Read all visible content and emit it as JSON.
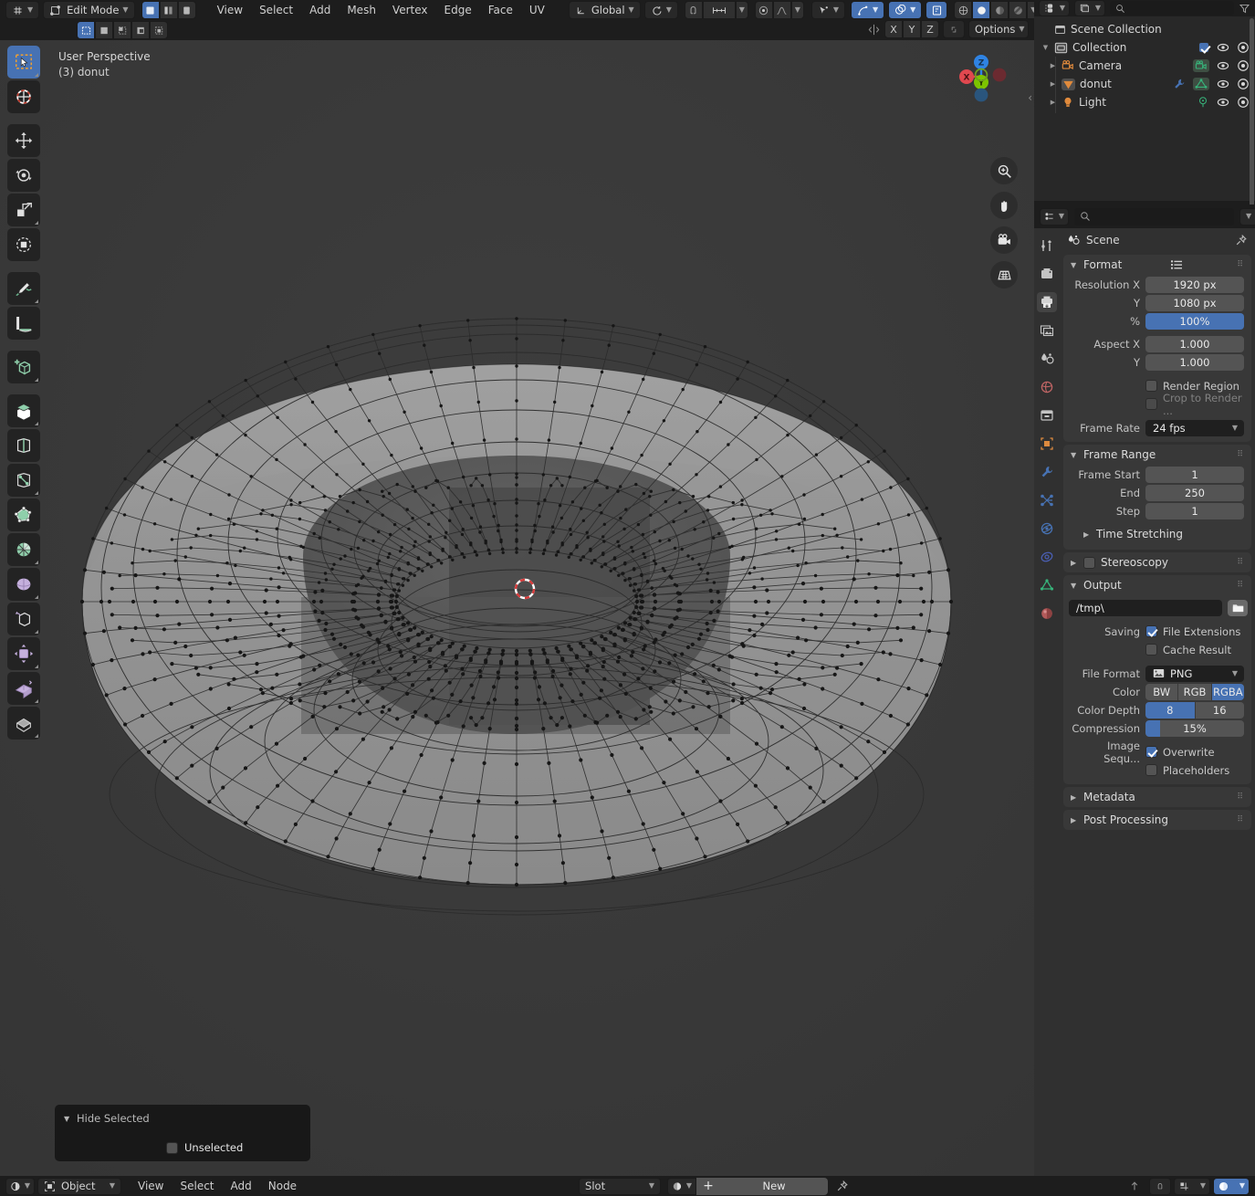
{
  "topbar": {
    "mode_label": "Edit Mode",
    "menus": [
      "View",
      "Select",
      "Add",
      "Mesh",
      "Vertex",
      "Edge",
      "Face",
      "UV"
    ],
    "transform_orientation": "Global",
    "options_label": "Options",
    "axis_locks": [
      "X",
      "Y",
      "Z"
    ],
    "mesh_select_modes": [
      "vertex-select",
      "edge-select",
      "face-select"
    ]
  },
  "viewport": {
    "perspective_label": "User Perspective",
    "object_label": "(3) donut",
    "gizmo_axes": [
      {
        "label": "Z",
        "color": "#2f83e3"
      },
      {
        "label": "Y",
        "color": "#7dc400"
      },
      {
        "label": "X",
        "color": "#e0484f"
      }
    ],
    "nav_buttons": [
      "zoom-icon",
      "pan-hand-icon",
      "camera-view-icon",
      "toggle-perspective-icon"
    ],
    "tools": [
      "tweak-select-box-tool",
      "cursor-tool",
      "move-tool",
      "rotate-tool",
      "scale-tool",
      "transform-tool",
      "annotate-tool",
      "measure-tool",
      "add-cube-tool",
      "extrude-region-tool",
      "inset-faces-tool",
      "bevel-tool",
      "loop-cut-tool",
      "knife-tool",
      "poly-build-tool",
      "spin-tool",
      "smooth-tool",
      "edge-slide-tool",
      "shrink-fatten-tool",
      "shear-tool",
      "rip-region-tool"
    ]
  },
  "operator_panel": {
    "title": "Hide Selected",
    "option_label": "Unselected",
    "option_checked": false
  },
  "outliner": {
    "display_mode": "view-layer-icon",
    "filter_icon": "filter-icon",
    "rows": [
      {
        "name": "Scene Collection",
        "icon": "scene-collection-icon",
        "indent": 0,
        "expander": "",
        "checkbox": false,
        "eye": false,
        "camera": false,
        "extra_icons": []
      },
      {
        "name": "Collection",
        "icon": "collection-icon",
        "indent": 0,
        "expander": "down",
        "checkbox": true,
        "eye": true,
        "camera": true,
        "extra_icons": []
      },
      {
        "name": "Camera",
        "icon": "camera-object-icon",
        "indent": 1,
        "expander": "right",
        "checkbox": false,
        "eye": true,
        "camera": true,
        "extra_icons": [
          "camera-data-icon"
        ]
      },
      {
        "name": "donut",
        "icon": "mesh-object-icon",
        "indent": 1,
        "expander": "right",
        "checkbox": false,
        "eye": true,
        "camera": true,
        "extra_icons": [
          "modifier-wrench-icon",
          "mesh-data-icon"
        ]
      },
      {
        "name": "Light",
        "icon": "light-object-icon",
        "indent": 1,
        "expander": "right",
        "checkbox": false,
        "eye": true,
        "camera": true,
        "extra_icons": [
          "light-data-icon"
        ]
      }
    ]
  },
  "properties": {
    "search_placeholder": "",
    "breadcrumb": "Scene",
    "breadcrumb_icon": "scene-properties-icon",
    "tabs": [
      "tool-icon",
      "render-icon",
      "output-icon",
      "view-layer-icon",
      "scene-icon",
      "world-icon",
      "collection-icon",
      "object-icon",
      "modifier-icon",
      "particles-icon",
      "physics-icon",
      "constraints-icon",
      "data-icon",
      "material-icon"
    ],
    "active_tab_index": 2,
    "panels": {
      "format": {
        "title": "Format",
        "open": true,
        "fields": [
          {
            "label": "Resolution X",
            "value": "1920 px",
            "style": "normal"
          },
          {
            "label": "Y",
            "value": "1080 px",
            "style": "normal"
          },
          {
            "label": "%",
            "value": "100%",
            "style": "blue"
          },
          {
            "label": "Aspect X",
            "value": "1.000",
            "style": "normal"
          },
          {
            "label": "Y",
            "value": "1.000",
            "style": "normal"
          }
        ],
        "checks": [
          {
            "label": "Render Region",
            "checked": false,
            "dim": false
          },
          {
            "label": "Crop to Render ...",
            "checked": false,
            "dim": true
          }
        ],
        "frame_rate_label": "Frame Rate",
        "frame_rate_value": "24 fps"
      },
      "frame_range": {
        "title": "Frame Range",
        "open": true,
        "fields": [
          {
            "label": "Frame Start",
            "value": "1"
          },
          {
            "label": "End",
            "value": "250"
          },
          {
            "label": "Step",
            "value": "1"
          }
        ]
      },
      "time_stretching": {
        "title": "Time Stretching",
        "open": false
      },
      "stereoscopy": {
        "title": "Stereoscopy",
        "open": false,
        "checked": false
      },
      "output": {
        "title": "Output",
        "open": true,
        "path": "/tmp\\",
        "saving_label": "Saving",
        "saving_checks": [
          {
            "label": "File Extensions",
            "checked": true
          },
          {
            "label": "Cache Result",
            "checked": false
          }
        ],
        "file_format_label": "File Format",
        "file_format_value": "PNG",
        "color_label": "Color",
        "color_options": [
          "BW",
          "RGB",
          "RGBA"
        ],
        "color_active": "RGBA",
        "color_depth_label": "Color Depth",
        "color_depth_options": [
          "8",
          "16"
        ],
        "color_depth_active": "8",
        "compression_label": "Compression",
        "compression_value": "15%",
        "compression_pct": 15,
        "image_seq_label": "Image Sequ...",
        "image_seq_checks": [
          {
            "label": "Overwrite",
            "checked": true
          },
          {
            "label": "Placeholders",
            "checked": false
          }
        ]
      },
      "metadata": {
        "title": "Metadata",
        "open": false
      },
      "post_processing": {
        "title": "Post Processing",
        "open": false
      }
    }
  },
  "bottombar": {
    "shading_type": "Object",
    "menus": [
      "View",
      "Select",
      "Add",
      "Node"
    ],
    "slot_label": "Slot",
    "new_button": "New",
    "pin_icon": "pin-icon",
    "snap_icon": "snap-magnet-icon",
    "overlay_icon": "overlays-icon"
  }
}
